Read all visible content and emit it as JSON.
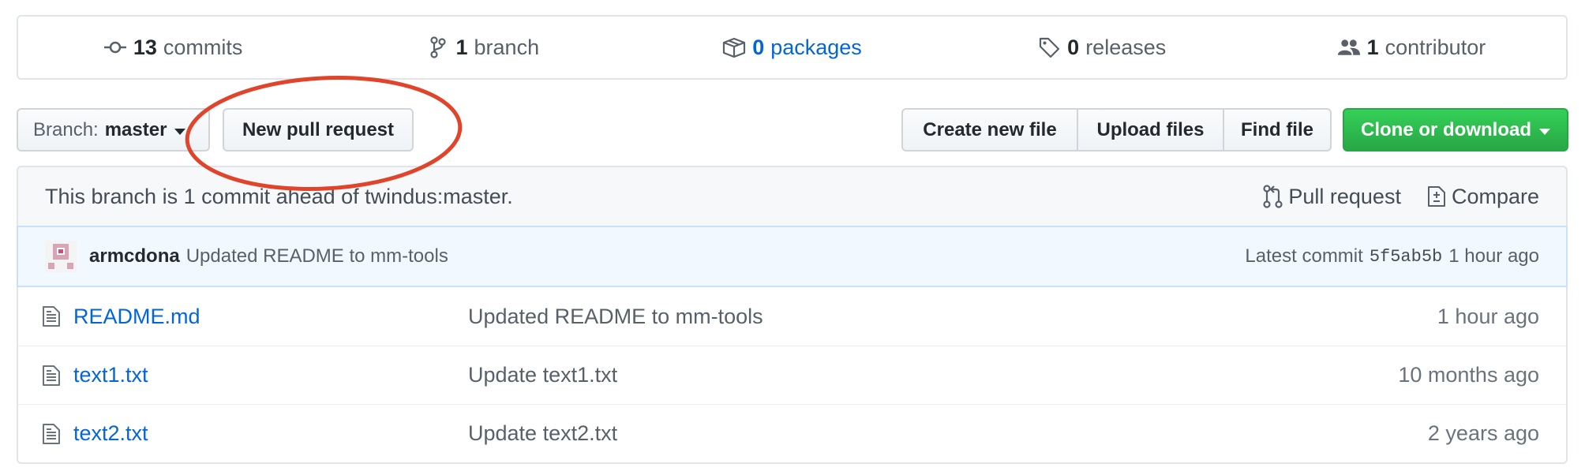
{
  "summary": {
    "commits": {
      "count": "13",
      "label": "commits"
    },
    "branches": {
      "count": "1",
      "label": "branch"
    },
    "packages": {
      "count": "0",
      "label": "packages"
    },
    "releases": {
      "count": "0",
      "label": "releases"
    },
    "contributors": {
      "count": "1",
      "label": "contributor"
    }
  },
  "toolbar": {
    "branch_prefix": "Branch:",
    "branch_name": "master",
    "new_pull_request": "New pull request",
    "create_new_file": "Create new file",
    "upload_files": "Upload files",
    "find_file": "Find file",
    "clone_or_download": "Clone or download"
  },
  "branch_info": {
    "text": "This branch is 1 commit ahead of twindus:master.",
    "pull_request": "Pull request",
    "compare": "Compare"
  },
  "commit": {
    "author": "armcdona",
    "message": "Updated README to mm-tools",
    "latest_label": "Latest commit",
    "sha": "5f5ab5b",
    "age": "1 hour ago"
  },
  "files": [
    {
      "name": "README.md",
      "message": "Updated README to mm-tools",
      "age": "1 hour ago"
    },
    {
      "name": "text1.txt",
      "message": "Update text1.txt",
      "age": "10 months ago"
    },
    {
      "name": "text2.txt",
      "message": "Update text2.txt",
      "age": "2 years ago"
    }
  ],
  "colors": {
    "link": "#0366d6",
    "clone_green": "#28a745",
    "annotation_red": "#e0442b",
    "commit_bg": "#f1f8ff"
  }
}
